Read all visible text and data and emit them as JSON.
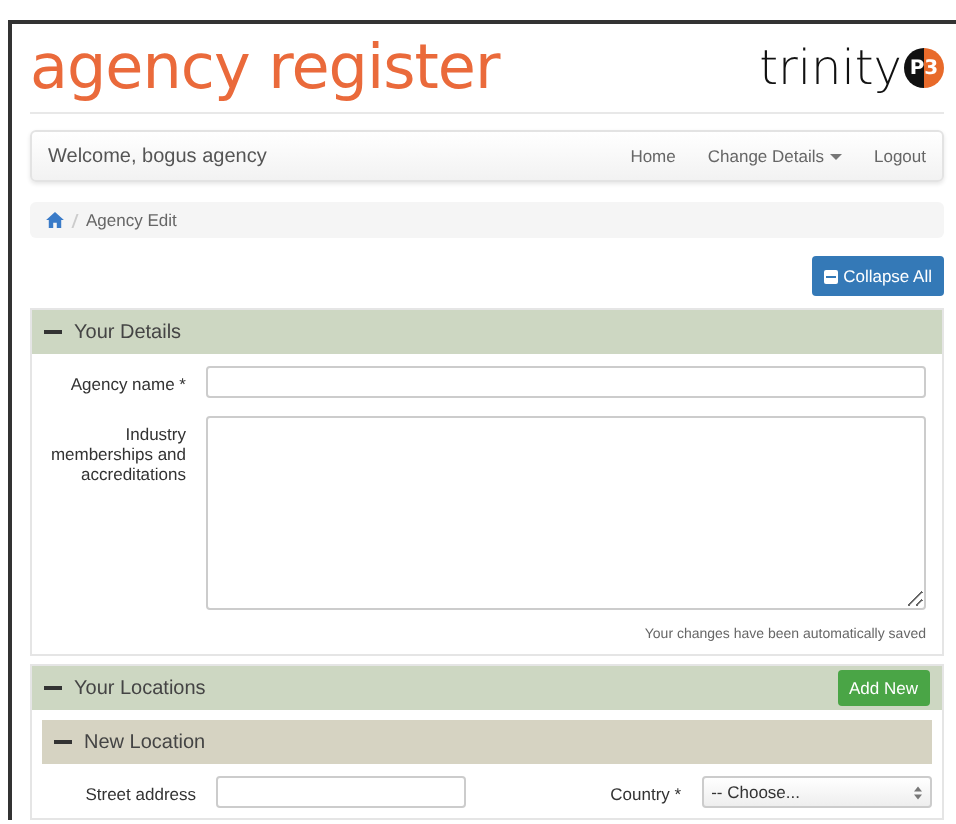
{
  "header": {
    "title": "agency register",
    "logo": {
      "text": "trinity",
      "badge": "P3"
    }
  },
  "navbar": {
    "welcome": "Welcome, bogus agency",
    "links": [
      {
        "label": "Home",
        "dropdown": false
      },
      {
        "label": "Change Details",
        "dropdown": true
      },
      {
        "label": "Logout",
        "dropdown": false
      }
    ]
  },
  "breadcrumb": {
    "items": [
      "Agency Edit"
    ]
  },
  "collapse_button": "Collapse All",
  "details": {
    "title": "Your Details",
    "fields": [
      {
        "label": "Agency name *",
        "kind": "input"
      },
      {
        "label": "Industry memberships and accreditations",
        "kind": "textarea"
      }
    ],
    "note": "Your changes have been automatically saved"
  },
  "locations": {
    "title": "Your Locations",
    "add_button": "Add New",
    "location": {
      "title": "New Location",
      "street_label": "Street address",
      "country_label": "Country *",
      "country_value": "-- Choose..."
    }
  }
}
